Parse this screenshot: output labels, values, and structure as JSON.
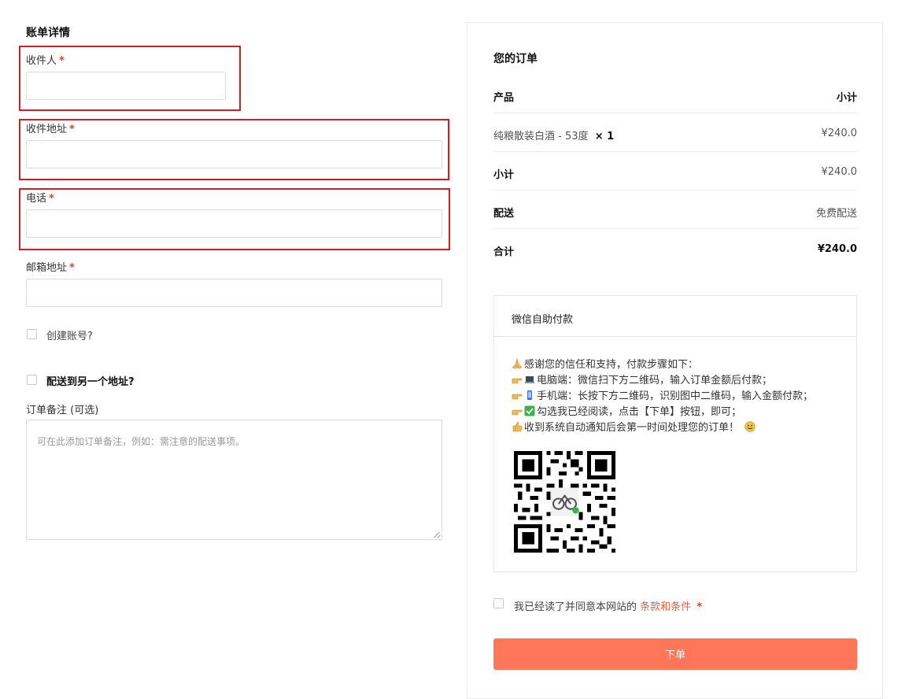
{
  "billing": {
    "title": "账单详情",
    "required_mark": "*",
    "fields": [
      {
        "label": "收件人",
        "value": ""
      },
      {
        "label": "收件地址",
        "value": ""
      },
      {
        "label": "电话",
        "value": ""
      },
      {
        "label": "邮箱地址",
        "value": ""
      }
    ],
    "create_account": "创建账号?",
    "ship_different": "配送到另一个地址?",
    "notes_label": "订单备注 (可选)",
    "notes_placeholder": "可在此添加订单备注，例如：需注意的配送事项。"
  },
  "order": {
    "title": "您的订单",
    "header": {
      "product": "产品",
      "subtotal": "小计"
    },
    "item": {
      "name": "纯粮散装白酒 - 53度",
      "qty": "× 1",
      "price": "¥240.0"
    },
    "subtotal": {
      "label": "小计",
      "value": "¥240.0"
    },
    "shipping": {
      "label": "配送",
      "value": "免费配送"
    },
    "total": {
      "label": "合计",
      "value": "¥240.0"
    }
  },
  "payment": {
    "title": "微信自助付款",
    "lines": [
      "感谢您的信任和支持，付款步骤如下：",
      "电脑端：微信扫下方二维码，输入订单金额后付款；",
      "手机端：长按下方二维码，识别图中二维码，输入金额付款；",
      "勾选我已经阅读，点击【下单】按钮，即可；",
      "收到系统自动通知后会第一时间处理您的订单！"
    ],
    "icons": [
      "pray-icon",
      "laptop-icon",
      "phone-icon",
      "check-icon",
      "thumbs-up-icon",
      "smile-icon"
    ]
  },
  "terms": {
    "text": "我已经读了并同意本网站的",
    "link": "条款和条件",
    "required_mark": "*"
  },
  "submit": {
    "label": "下单"
  },
  "colors": {
    "accent": "#ff7658",
    "required": "#e2401c",
    "highlight": "#d11f26",
    "link": "#e8613c"
  }
}
